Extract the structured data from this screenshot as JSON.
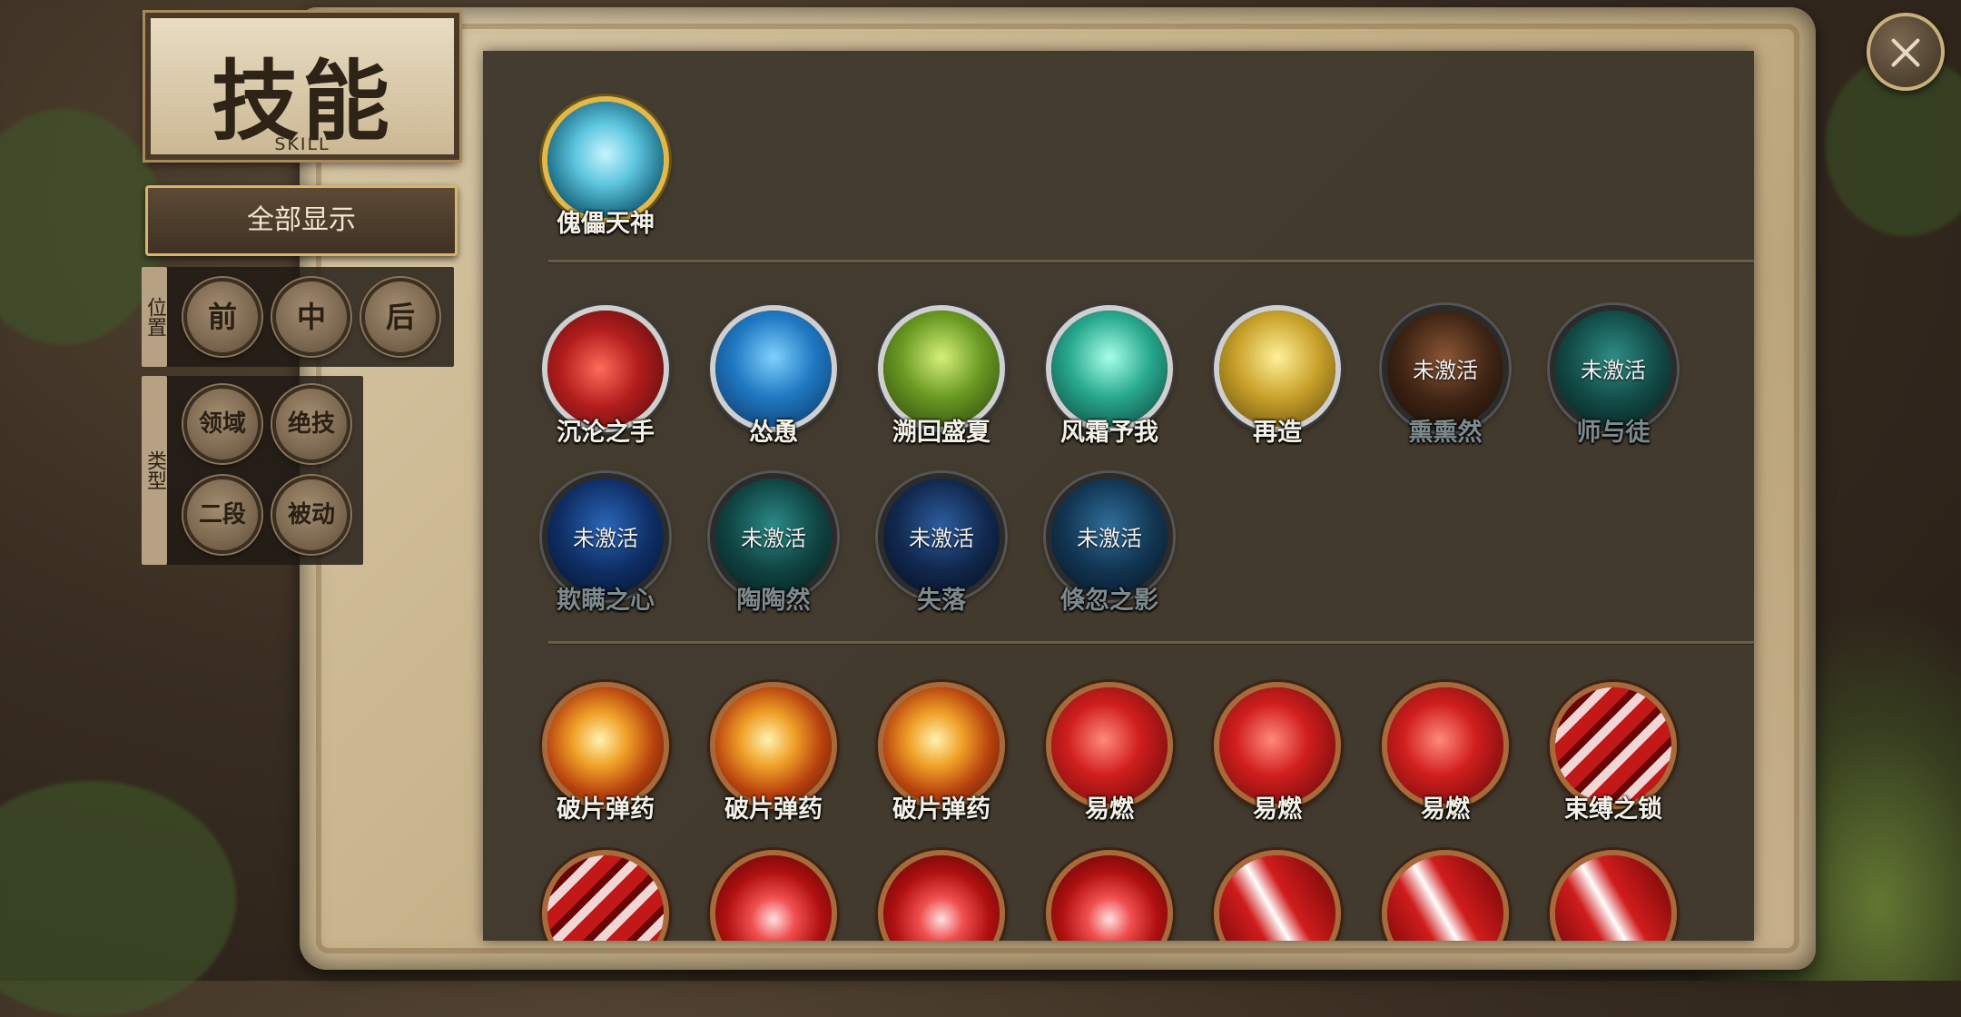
{
  "header": {
    "title_zh": "技能",
    "title_en": "SKILL"
  },
  "filters": {
    "show_all": "全部显示",
    "position_label": "位置",
    "positions": [
      "前",
      "中",
      "后"
    ],
    "type_label": "类型",
    "types": [
      "领域",
      "绝技",
      "二段",
      "被动"
    ]
  },
  "skills": {
    "ultimate": [
      {
        "name": "傀儡天神",
        "icon": "ghost-hand-icon"
      }
    ],
    "active": [
      {
        "name": "沉沦之手",
        "icon": "red-warrior-icon",
        "status": ""
      },
      {
        "name": "怂恿",
        "icon": "blue-beast-icon",
        "status": ""
      },
      {
        "name": "溯回盛夏",
        "icon": "green-forest-icon",
        "status": ""
      },
      {
        "name": "风霜予我",
        "icon": "teal-spirit-icon",
        "status": ""
      },
      {
        "name": "再造",
        "icon": "golden-figure-icon",
        "status": ""
      },
      {
        "name": "熏熏然",
        "icon": "brown-swirl-icon",
        "status": "未激活"
      },
      {
        "name": "师与徒",
        "icon": "teal-fog-icon",
        "status": "未激活"
      },
      {
        "name": "欺瞒之心",
        "icon": "blue-orb-icon",
        "status": "未激活"
      },
      {
        "name": "陶陶然",
        "icon": "teal-wind-icon",
        "status": "未激活"
      },
      {
        "name": "失落",
        "icon": "blue-anchor-icon",
        "status": "未激活"
      },
      {
        "name": "倏忽之影",
        "icon": "blue-shadow-icon",
        "status": "未激活"
      }
    ],
    "passive": [
      {
        "name": "破片弹药",
        "icon": "fire-claw-icon"
      },
      {
        "name": "破片弹药",
        "icon": "fire-claw-icon"
      },
      {
        "name": "破片弹药",
        "icon": "fire-claw-icon"
      },
      {
        "name": "易燃",
        "icon": "red-flame-icon"
      },
      {
        "name": "易燃",
        "icon": "red-flame-icon"
      },
      {
        "name": "易燃",
        "icon": "red-flame-icon"
      },
      {
        "name": "束缚之锁",
        "icon": "chain-icon"
      },
      {
        "name": "",
        "icon": "chain-icon"
      },
      {
        "name": "",
        "icon": "red-swirl-icon"
      },
      {
        "name": "",
        "icon": "red-swirl-icon"
      },
      {
        "name": "",
        "icon": "red-swirl-icon"
      },
      {
        "name": "",
        "icon": "red-slash-icon"
      },
      {
        "name": "",
        "icon": "red-slash-icon"
      },
      {
        "name": "",
        "icon": "red-slash-icon"
      }
    ]
  },
  "status_inactive": "未激活",
  "colors": {
    "panel": "#393128",
    "gold": "#e0b94a",
    "text_active": "#f3f0e6",
    "text_inactive": "#7e8a8e"
  }
}
